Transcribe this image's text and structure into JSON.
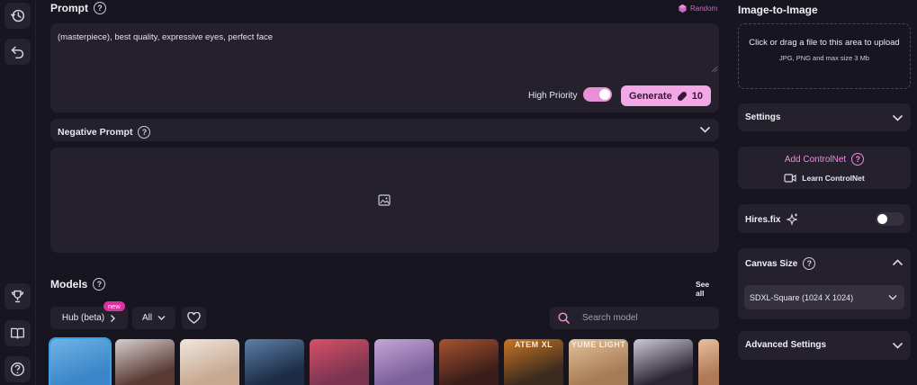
{
  "sidebar": {
    "buttons": [
      "history-icon",
      "undo-icon",
      "trophy-icon",
      "book-icon",
      "help-icon"
    ]
  },
  "prompt": {
    "title": "Prompt",
    "random_label": "Random",
    "value": "(masterpiece), best quality, expressive eyes, perfect face",
    "high_priority_label": "High Priority",
    "high_priority_on": true,
    "generate_label": "Generate",
    "generate_cost": "10"
  },
  "negative_prompt": {
    "title": "Negative Prompt"
  },
  "models": {
    "title": "Models",
    "see_all": "See all",
    "hub_label": "Hub (beta)",
    "new_badge": "new",
    "filter_label": "All",
    "search_placeholder": "Search model",
    "thumbnails": [
      {
        "name": "model-1",
        "colors": [
          "#3b86c9",
          "#6fb4e6"
        ],
        "label": ""
      },
      {
        "name": "model-2",
        "colors": [
          "#5a3b34",
          "#d8cfd0"
        ],
        "label": ""
      },
      {
        "name": "model-3",
        "colors": [
          "#c7a890",
          "#f0e6de"
        ],
        "label": ""
      },
      {
        "name": "model-4",
        "colors": [
          "#1c2d45",
          "#5d7fa8"
        ],
        "label": ""
      },
      {
        "name": "model-5",
        "colors": [
          "#7a3450",
          "#d85068"
        ],
        "label": ""
      },
      {
        "name": "model-6",
        "colors": [
          "#7b5f99",
          "#c7a6d8"
        ],
        "label": ""
      },
      {
        "name": "model-7",
        "colors": [
          "#3a1d1a",
          "#a8532e"
        ],
        "label": ""
      },
      {
        "name": "model-8",
        "colors": [
          "#3b2a1e",
          "#c97524"
        ],
        "label": "ATEM XL"
      },
      {
        "name": "model-9",
        "colors": [
          "#a67a55",
          "#e2c29a"
        ],
        "label": "YUME LIGHT"
      },
      {
        "name": "model-10",
        "colors": [
          "#2a2530",
          "#cfcad6"
        ],
        "label": ""
      },
      {
        "name": "model-11",
        "colors": [
          "#b07a57",
          "#e8c0a0"
        ],
        "label": ""
      }
    ]
  },
  "right_panel": {
    "title": "Image-to-Image",
    "upload_text": "Click or drag a file to this area to upload",
    "upload_hint": "JPG, PNG and max size 3 Mb",
    "settings_label": "Settings",
    "add_controlnet": "Add ControlNet",
    "learn_controlnet": "Learn ControlNet",
    "hires_label": "Hires.fix",
    "hires_on": false,
    "canvas_size_label": "Canvas Size",
    "canvas_size_value": "SDXL-Square (1024 X 1024)",
    "advanced_label": "Advanced Settings"
  },
  "colors": {
    "background": "#17151f",
    "panel": "#24212d",
    "accent_pink": "#f2a7e6",
    "badge_pink": "#e0309e"
  }
}
